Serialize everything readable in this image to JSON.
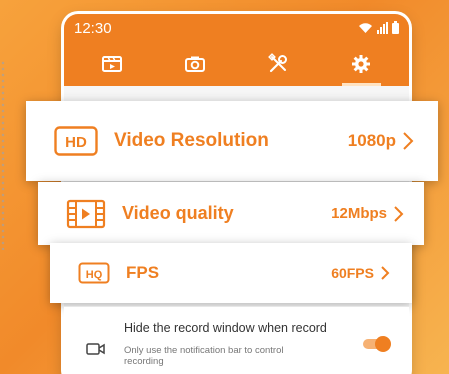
{
  "status_bar": {
    "time": "12:30"
  },
  "tabs": [
    {
      "icon": "video-clip-icon"
    },
    {
      "icon": "camera-icon"
    },
    {
      "icon": "tools-icon"
    },
    {
      "icon": "gear-icon",
      "active": true
    }
  ],
  "settings": {
    "video_resolution": {
      "icon": "hd-icon",
      "icon_text": "HD",
      "label": "Video Resolution",
      "value": "1080p"
    },
    "video_quality": {
      "icon": "film-play-icon",
      "label": "Video quality",
      "value": "12Mbps"
    },
    "fps": {
      "icon": "hq-icon",
      "icon_text": "HQ",
      "label": "FPS",
      "value": "60FPS"
    },
    "hide_record_window": {
      "icon": "camcorder-icon",
      "title": "Hide the record window when record",
      "subtitle": "Only use the notification bar to control recording",
      "enabled": true
    }
  },
  "colors": {
    "accent": "#ef7f21",
    "background_gradient": [
      "#f7a23c",
      "#f18a2a",
      "#f7b450"
    ]
  }
}
